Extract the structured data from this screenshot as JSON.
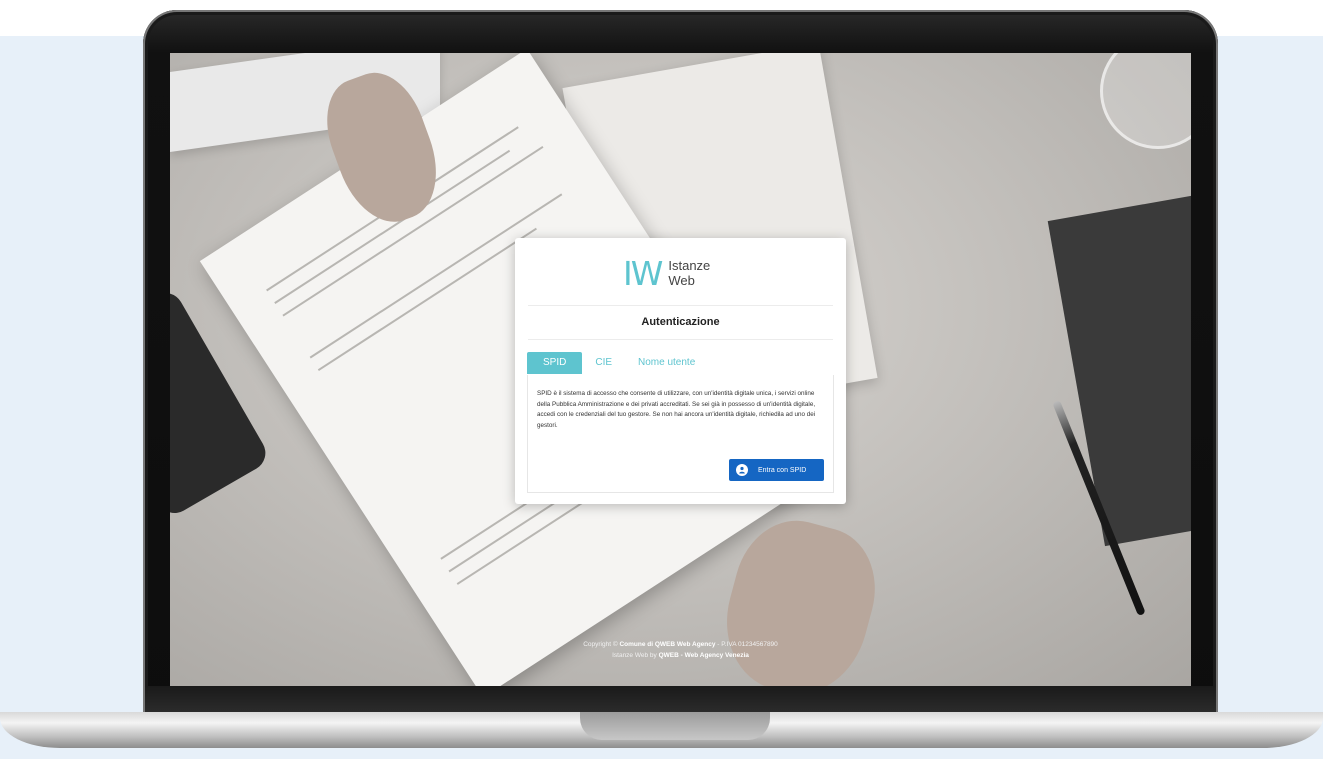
{
  "brand": {
    "mark": "IW",
    "name_line1": "Istanze",
    "name_line2": "Web",
    "accent_color": "#5ec4cf"
  },
  "auth": {
    "title": "Autenticazione",
    "tabs": [
      {
        "label": "SPID",
        "active": true
      },
      {
        "label": "CIE",
        "active": false
      },
      {
        "label": "Nome utente",
        "active": false
      }
    ],
    "description": "SPID è il sistema di accesso che consente di utilizzare, con un'identità digitale unica, i servizi online della Pubblica Amministrazione e dei privati accreditati. Se sei già in possesso di un'identità digitale, accedi con le credenziali del tuo gestore. Se non hai ancora un'identità digitale, richiedila ad uno dei gestori.",
    "spid_button": {
      "label": "Entra con SPID",
      "icon": "user-icon",
      "color": "#1566c3"
    }
  },
  "footer": {
    "line1_prefix": "Copyright © ",
    "line1_org": "Comune di QWEB Web Agency",
    "line1_suffix": " - P.IVA 01234567890",
    "line2_prefix": "Istanze Web by ",
    "line2_agency": "QWEB - Web Agency Venezia"
  }
}
